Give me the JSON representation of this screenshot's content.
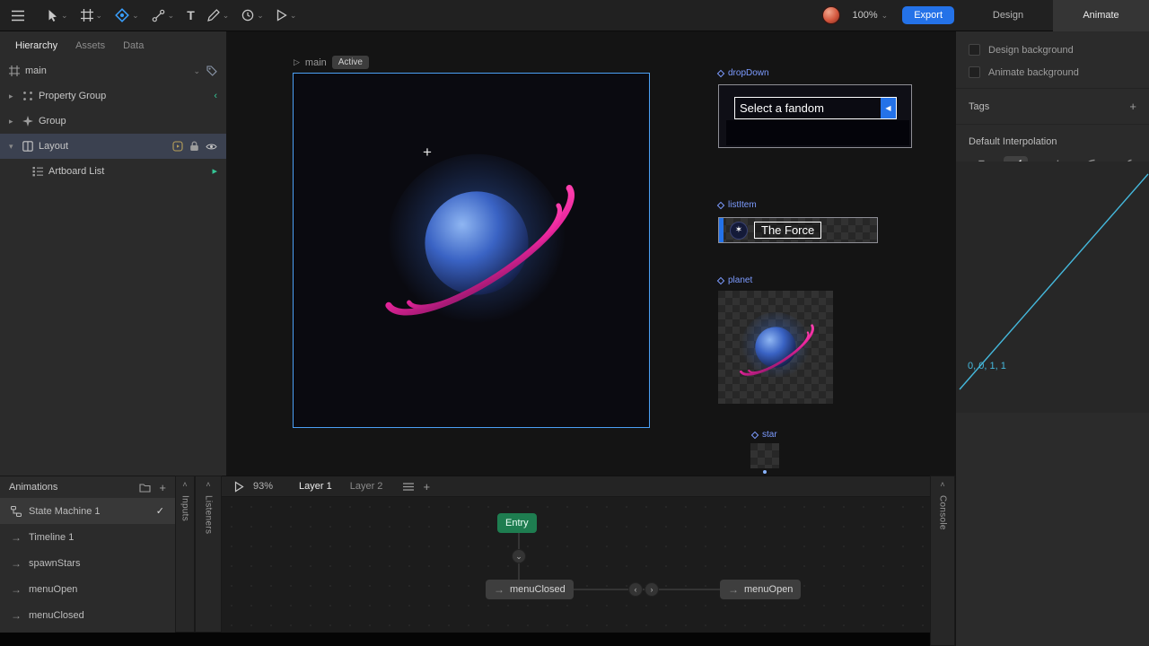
{
  "toolbar": {
    "zoom": "100%",
    "export_label": "Export",
    "mode_design": "Design",
    "mode_animate": "Animate",
    "active_mode": "Animate"
  },
  "left_panel": {
    "tabs": [
      {
        "label": "Hierarchy",
        "active": true
      },
      {
        "label": "Assets",
        "active": false
      },
      {
        "label": "Data",
        "active": false
      }
    ],
    "tree": [
      {
        "label": "main"
      },
      {
        "label": "Property Group"
      },
      {
        "label": "Group"
      },
      {
        "label": "Layout",
        "selected": true
      },
      {
        "label": "Artboard List"
      }
    ]
  },
  "animations": {
    "title": "Animations",
    "items": [
      {
        "label": "State Machine 1",
        "selected": true
      },
      {
        "label": "Timeline 1"
      },
      {
        "label": "spawnStars"
      },
      {
        "label": "menuOpen"
      },
      {
        "label": "menuClosed"
      }
    ]
  },
  "stage": {
    "artboard_name": "main",
    "artboard_state": "Active",
    "components": {
      "dropdown": {
        "label": "dropDown",
        "value": "Select a fandom"
      },
      "list_item": {
        "label": "listItem",
        "text": "The Force"
      },
      "planet": {
        "label": "planet"
      },
      "star": {
        "label": "star"
      }
    }
  },
  "state_machine": {
    "zoom": "93%",
    "layers": [
      {
        "label": "Layer 1",
        "active": true
      },
      {
        "label": "Layer 2",
        "active": false
      }
    ],
    "entry_label": "Entry",
    "states": [
      {
        "label": "menuClosed"
      },
      {
        "label": "menuOpen"
      }
    ]
  },
  "inspector": {
    "bg_options": [
      "Design background",
      "Animate background"
    ],
    "tags_title": "Tags",
    "interpolation_title": "Default Interpolation",
    "curve_values": "0, 0, 1, 1"
  },
  "side_tabs": {
    "inputs": "Inputs",
    "listeners": "Listeners",
    "console": "Console"
  },
  "icons": {
    "chevron_down": "⌄",
    "chevron_up": "˄",
    "caret_right": "▸",
    "caret_down": "▾",
    "arrow_right": "→",
    "check": "✓",
    "plus": "+",
    "play_outline": "▷",
    "tri_left": "◀",
    "angle_left": "‹",
    "angle_right": "›",
    "emblem": "✶",
    "cursor_plus": "+",
    "text_tool": "T",
    "teal_play": "▸",
    "teal_back": "‹"
  },
  "colors": {
    "accent_blue": "#2472e8",
    "selection_blue": "#4ba0f5",
    "curve_cyan": "#45b9dd",
    "entry_green": "#1e7d50",
    "ring_pink": "#e8259c",
    "component_label": "#7c9bff"
  }
}
